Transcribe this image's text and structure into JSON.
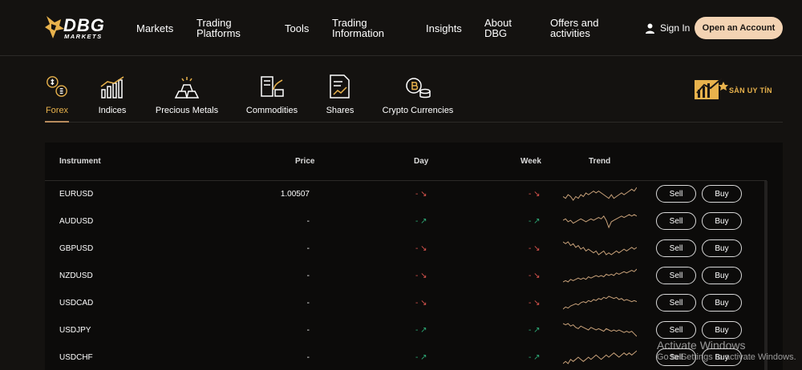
{
  "brand": {
    "name": "DBG",
    "sub": "MARKETS"
  },
  "nav": [
    {
      "label": "Markets"
    },
    {
      "label": "Trading Platforms"
    },
    {
      "label": "Tools"
    },
    {
      "label": "Trading Information"
    },
    {
      "label": "Insights"
    },
    {
      "label": "About DBG"
    },
    {
      "label": "Offers and activities"
    }
  ],
  "auth": {
    "signin": "Sign In",
    "open_account": "Open an Account"
  },
  "categories": [
    {
      "label": "Forex",
      "icon": "forex-icon",
      "active": true
    },
    {
      "label": "Indices",
      "icon": "indices-icon"
    },
    {
      "label": "Precious Metals",
      "icon": "gold-bars-icon"
    },
    {
      "label": "Commodities",
      "icon": "commodities-icon"
    },
    {
      "label": "Shares",
      "icon": "shares-icon"
    },
    {
      "label": "Crypto Currencies",
      "icon": "crypto-icon"
    }
  ],
  "badge": {
    "text": "SÀN UY TÍN",
    "icon": "chart-badge-icon"
  },
  "table": {
    "headers": {
      "instrument": "Instrument",
      "price": "Price",
      "day": "Day",
      "week": "Week",
      "trend": "Trend"
    },
    "sell_label": "Sell",
    "buy_label": "Buy",
    "rows": [
      {
        "instrument": "EURUSD",
        "price": "1.00507",
        "day": "- ↘",
        "day_dir": "down",
        "week": "- ↘",
        "week_dir": "down",
        "trend": [
          10,
          9,
          11,
          10,
          8,
          10,
          9,
          11,
          10,
          12,
          11,
          12,
          13,
          12,
          13,
          12,
          11,
          10,
          9,
          11,
          9,
          10,
          11,
          12,
          11,
          12,
          13,
          14,
          13,
          15
        ]
      },
      {
        "instrument": "AUDUSD",
        "price": "-",
        "day": "- ↗",
        "day_dir": "up",
        "week": "- ↗",
        "week_dir": "up",
        "trend": [
          9,
          10,
          8,
          9,
          7,
          8,
          9,
          10,
          9,
          8,
          9,
          10,
          9,
          10,
          11,
          10,
          12,
          9,
          4,
          8,
          9,
          10,
          11,
          12,
          11,
          12,
          13,
          12,
          13,
          12
        ]
      },
      {
        "instrument": "GBPUSD",
        "price": "-",
        "day": "- ↘",
        "day_dir": "down",
        "week": "- ↘",
        "week_dir": "down",
        "trend": [
          13,
          12,
          13,
          11,
          12,
          10,
          11,
          9,
          10,
          8,
          9,
          8,
          7,
          8,
          6,
          7,
          8,
          6,
          7,
          6,
          7,
          8,
          7,
          8,
          9,
          8,
          9,
          10,
          9,
          10
        ]
      },
      {
        "instrument": "NZDUSD",
        "price": "-",
        "day": "- ↘",
        "day_dir": "down",
        "week": "- ↘",
        "week_dir": "down",
        "trend": [
          5,
          6,
          5,
          7,
          6,
          7,
          8,
          7,
          8,
          7,
          9,
          8,
          9,
          10,
          9,
          10,
          9,
          11,
          10,
          11,
          10,
          12,
          11,
          12,
          13,
          12,
          13,
          14,
          13,
          15
        ]
      },
      {
        "instrument": "USDCAD",
        "price": "-",
        "day": "- ↘",
        "day_dir": "down",
        "week": "- ↘",
        "week_dir": "down",
        "trend": [
          4,
          6,
          5,
          7,
          8,
          9,
          8,
          10,
          11,
          10,
          12,
          11,
          13,
          12,
          14,
          13,
          15,
          14,
          16,
          15,
          14,
          15,
          13,
          14,
          12,
          13,
          12,
          11,
          12,
          11
        ]
      },
      {
        "instrument": "USDJPY",
        "price": "-",
        "day": "- ↗",
        "day_dir": "up",
        "week": "- ↗",
        "week_dir": "up",
        "trend": [
          15,
          14,
          15,
          13,
          14,
          12,
          11,
          13,
          12,
          11,
          10,
          12,
          11,
          10,
          11,
          10,
          9,
          11,
          10,
          9,
          10,
          9,
          10,
          9,
          8,
          9,
          8,
          9,
          7,
          5
        ]
      },
      {
        "instrument": "USDCHF",
        "price": "-",
        "day": "- ↗",
        "day_dir": "up",
        "week": "- ↗",
        "week_dir": "up",
        "trend": [
          8,
          9,
          8,
          10,
          9,
          10,
          11,
          10,
          9,
          10,
          11,
          10,
          11,
          12,
          11,
          10,
          11,
          12,
          11,
          12,
          13,
          12,
          11,
          12,
          13,
          12,
          13,
          12,
          13,
          14
        ]
      }
    ]
  },
  "activate_windows": {
    "line1": "Activate Windows",
    "line2": "Go to Settings to activate Windows."
  }
}
